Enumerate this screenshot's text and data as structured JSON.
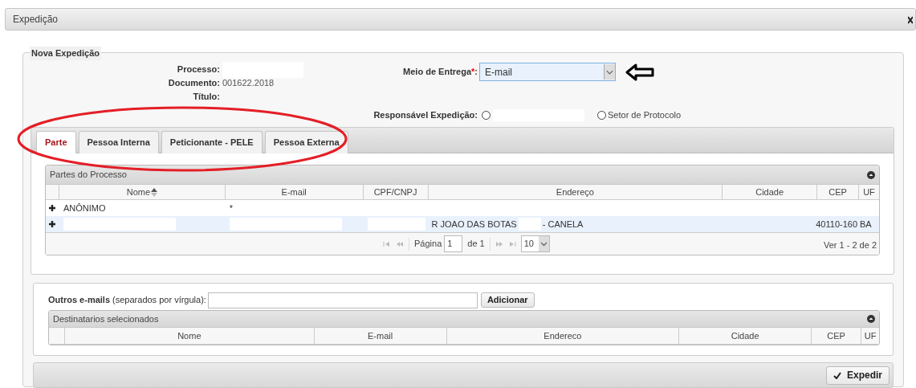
{
  "window": {
    "title": "Expedição"
  },
  "form": {
    "legend": "Nova Expedição",
    "info": [
      {
        "label": "Processo:",
        "kind": "redacted"
      },
      {
        "label": "Documento:",
        "kind": "text",
        "value": "001622.2018"
      },
      {
        "label": "Título:",
        "kind": "empty"
      }
    ],
    "delivery": {
      "label": "Meio de Entrega",
      "required_mark": "*",
      "suffix": ":",
      "value": "E-mail"
    },
    "responsible": {
      "label": "Responsável Expedição:",
      "options": [
        {
          "kind": "redacted",
          "checked": false
        },
        {
          "kind": "text",
          "label": "Setor de Protocolo",
          "checked": false
        }
      ]
    }
  },
  "tabs": [
    {
      "label": "Parte",
      "selected": true
    },
    {
      "label": "Pessoa Interna",
      "selected": false
    },
    {
      "label": "Peticionante - PELE",
      "selected": false
    },
    {
      "label": "Pessoa Externa",
      "selected": false
    }
  ],
  "parties_grid": {
    "caption": "Partes do Processo",
    "columns": [
      {
        "label": "Nome",
        "sortable": true
      },
      {
        "label": "E-mail",
        "sortable": false
      },
      {
        "label": "CPF/CNPJ",
        "sortable": false
      },
      {
        "label": "Endereço",
        "sortable": false
      },
      {
        "label": "Cidade",
        "sortable": false
      },
      {
        "label": "CEP",
        "sortable": false
      },
      {
        "label": "UF",
        "sortable": false
      }
    ],
    "rows": [
      {
        "selected": false,
        "cells": [
          {
            "kind": "text",
            "text": "ANÔNIMO"
          },
          {
            "kind": "text",
            "text": "*"
          },
          {
            "kind": "empty"
          },
          {
            "kind": "empty"
          },
          {
            "kind": "empty"
          },
          {
            "kind": "empty"
          },
          {
            "kind": "empty"
          }
        ]
      },
      {
        "selected": true,
        "cells": [
          {
            "kind": "redacted"
          },
          {
            "kind": "redacted"
          },
          {
            "kind": "redacted"
          },
          {
            "kind": "split",
            "parts": [
              "R JOAO DAS BOTAS",
              "- CANELA"
            ]
          },
          {
            "kind": "empty"
          },
          {
            "kind": "text",
            "text": "40110-160"
          },
          {
            "kind": "text",
            "text": "BA"
          }
        ]
      }
    ],
    "pager": {
      "page_label": "Página",
      "page": "1",
      "of": "de 1",
      "page_size": "10",
      "summary": "Ver 1 - 2 de 2"
    }
  },
  "recipients": {
    "label_bold": "Outros e-mails",
    "label_rest": "(separados por vírgula):",
    "add_button": "Adicionar",
    "grid": {
      "caption": "Destinatarios selecionados",
      "columns": [
        "Nome",
        "E-mail",
        "Endereco",
        "Cidade",
        "CEP",
        "UF"
      ]
    }
  },
  "submit_button": "Expedir"
}
